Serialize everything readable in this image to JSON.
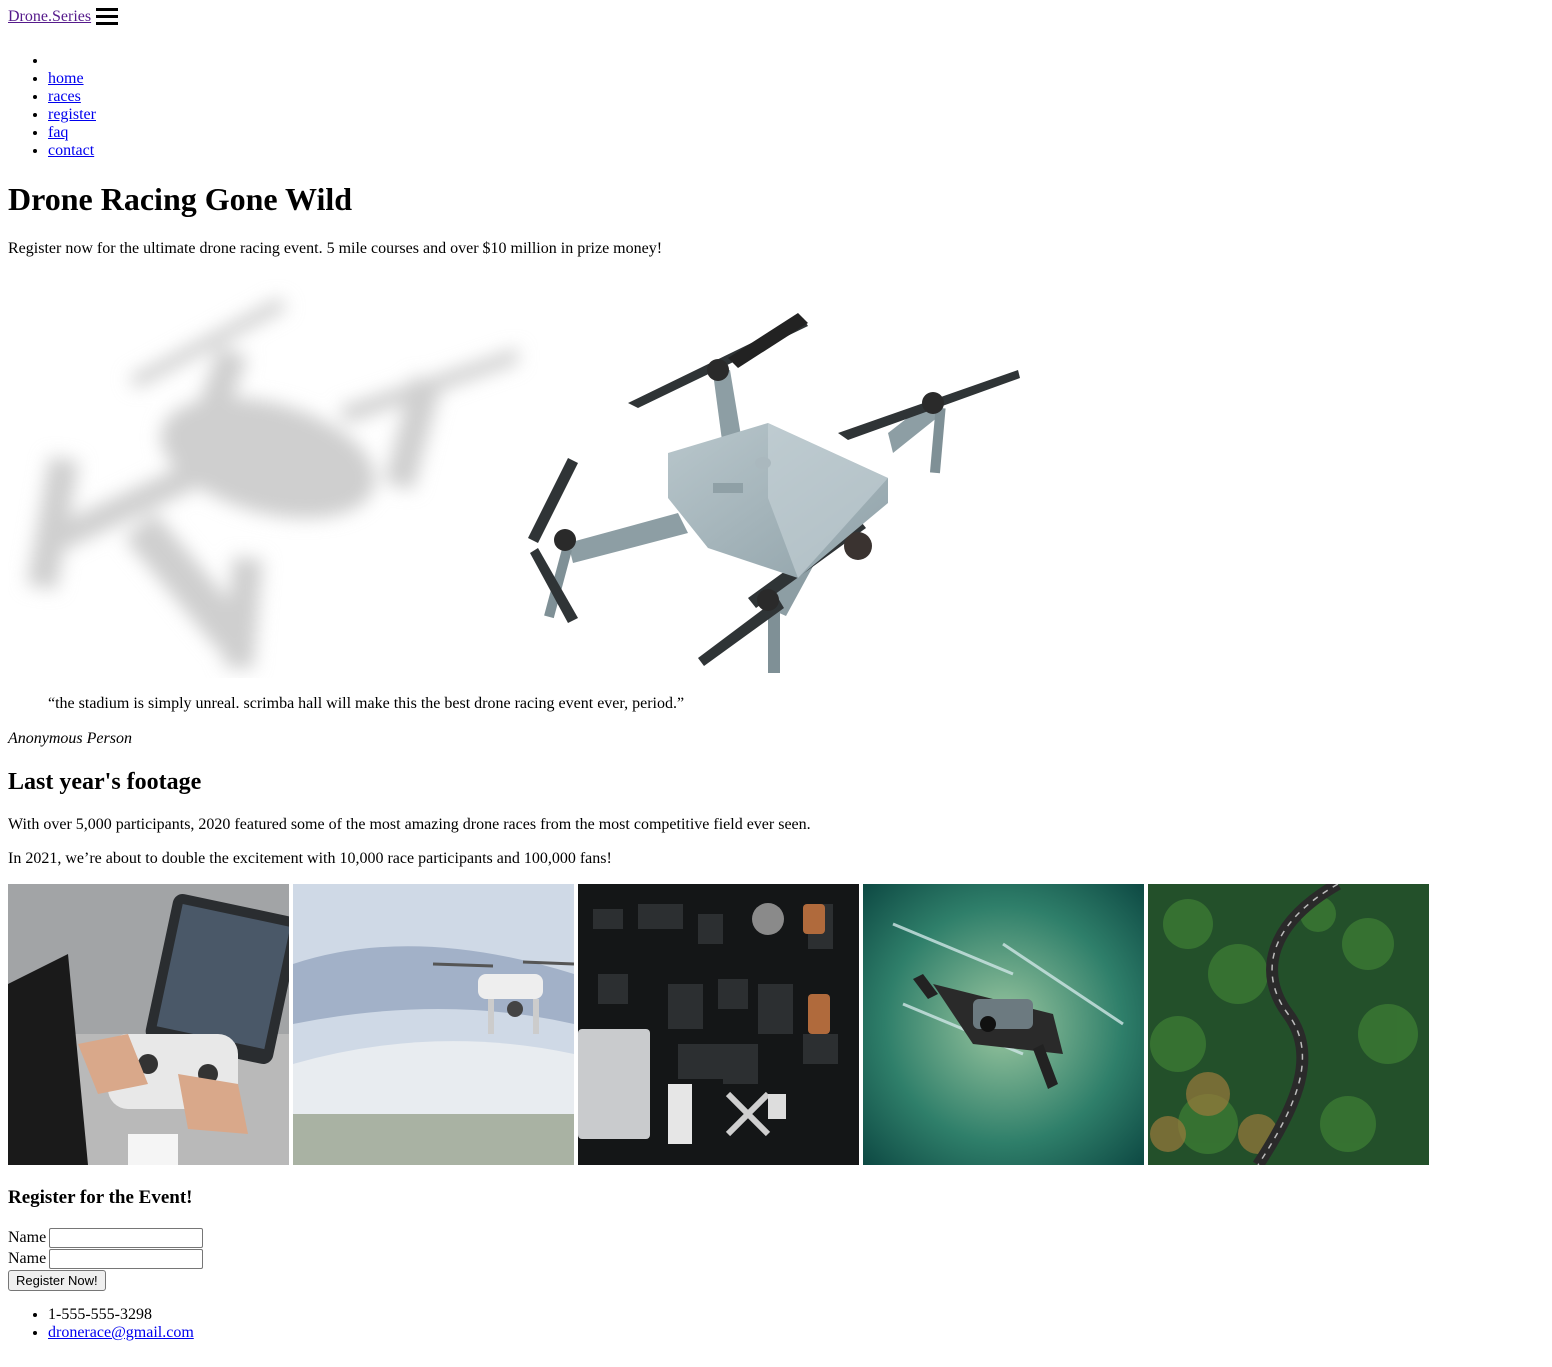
{
  "header": {
    "logo": "Drone.Series"
  },
  "nav": {
    "items": [
      "home",
      "races",
      "register",
      "faq",
      "contact"
    ]
  },
  "hero": {
    "title": "Drone Racing Gone Wild",
    "tagline": "Register now for the ultimate drone racing event. 5 mile courses and over $10 million in prize money!"
  },
  "testimonial": {
    "quote": "“the stadium is simply unreal. scrimba hall will make this the best drone racing event ever, period.”",
    "author": "Anonymous Person"
  },
  "footage": {
    "heading": "Last year's footage",
    "para1": "With over 5,000 participants, 2020 featured some of the most amazing drone races from the most competitive field ever seen.",
    "para2": "In 2021, we’re about to double the excitement with 10,000 race participants and 100,000 fans!"
  },
  "register": {
    "heading": "Register for the Event!",
    "field1_label": "Name",
    "field2_label": "Name",
    "field1_value": "",
    "field2_value": "",
    "submit_label": "Register Now!"
  },
  "contact": {
    "phone": "1-555-555-3298",
    "email": "dronerace@gmail.com"
  },
  "colors": {
    "link": "#0000ee",
    "visited_link": "#551a8b"
  }
}
